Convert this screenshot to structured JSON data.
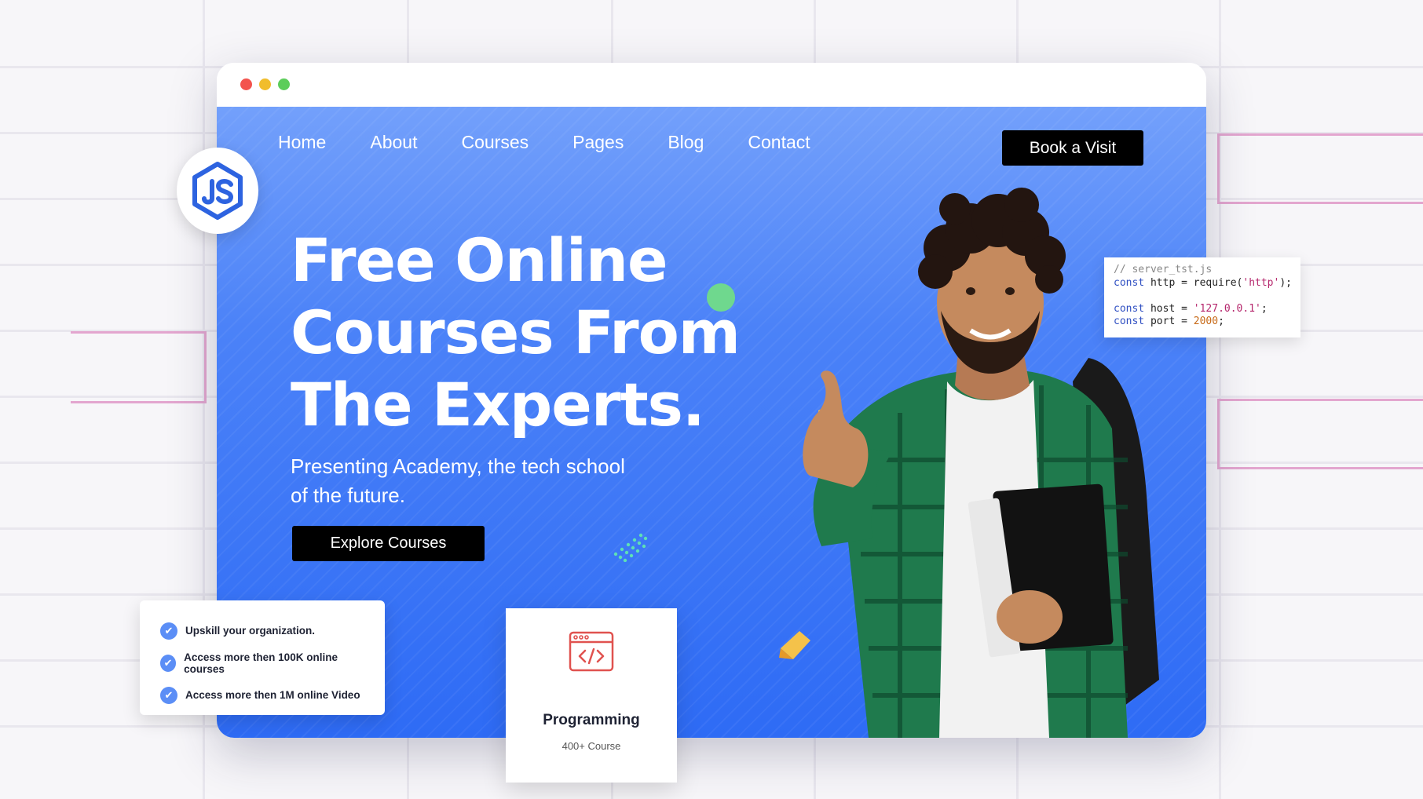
{
  "nav": {
    "items": [
      "Home",
      "About",
      "Courses",
      "Pages",
      "Blog",
      "Contact"
    ],
    "cta": "Book a Visit"
  },
  "hero": {
    "headline": [
      "Free Online",
      "Courses From",
      "The Experts."
    ],
    "subtitle": "Presenting Academy, the tech school of the future.",
    "cta": "Explore Courses"
  },
  "code_card": {
    "lines": [
      "// server_tst.js",
      "const http = require('http');",
      "",
      "const host = '127.0.0.1';",
      "const port = 2000;"
    ]
  },
  "checklist": {
    "items": [
      "Upskill your organization.",
      "Access more then 100K online courses",
      "Access more then 1M online Video"
    ]
  },
  "category_card": {
    "title": "Programming",
    "subtitle": "400+ Course",
    "icon": "code-window-icon"
  },
  "badge": {
    "icon": "nodejs-icon",
    "label": "JS"
  },
  "colors": {
    "hero_top": "#73a0fb",
    "hero_bottom": "#2e6bf5",
    "button_bg": "#000000",
    "check_icon": "#5b8ef6",
    "code_icon": "#e0524f"
  }
}
